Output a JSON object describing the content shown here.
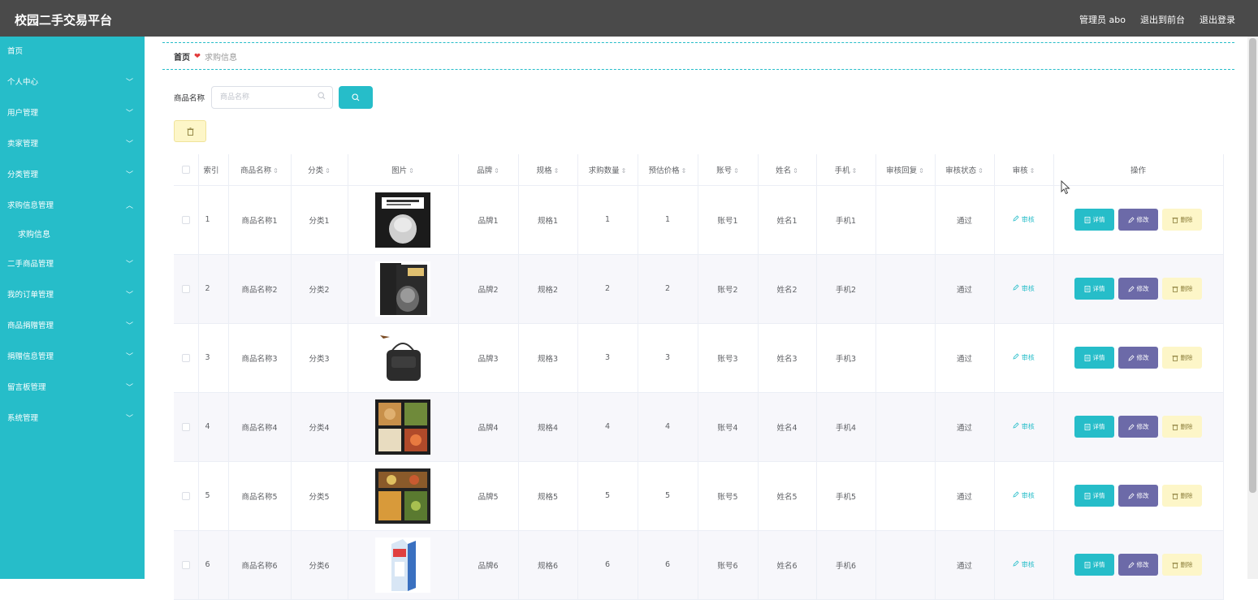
{
  "app": {
    "title": "校园二手交易平台",
    "user_label": "管理员 abo",
    "to_front": "退出到前台",
    "logout": "退出登录"
  },
  "sidebar": {
    "items": [
      {
        "label": "首页",
        "chevron": ""
      },
      {
        "label": "个人中心",
        "chevron": "﹀"
      },
      {
        "label": "用户管理",
        "chevron": "﹀"
      },
      {
        "label": "卖家管理",
        "chevron": "﹀"
      },
      {
        "label": "分类管理",
        "chevron": "﹀"
      },
      {
        "label": "求购信息管理",
        "chevron": "︿"
      },
      {
        "label": "求购信息",
        "chevron": ""
      },
      {
        "label": "二手商品管理",
        "chevron": "﹀"
      },
      {
        "label": "我的订单管理",
        "chevron": "﹀"
      },
      {
        "label": "商品捐赠管理",
        "chevron": "﹀"
      },
      {
        "label": "捐赠信息管理",
        "chevron": "﹀"
      },
      {
        "label": "留言板管理",
        "chevron": "﹀"
      },
      {
        "label": "系统管理",
        "chevron": "﹀"
      }
    ]
  },
  "breadcrumb": {
    "home": "首页",
    "separator": "❤",
    "current": "求购信息"
  },
  "search": {
    "label": "商品名称",
    "placeholder": "商品名称"
  },
  "icons": {
    "search": "search-icon",
    "delete": "trash-icon",
    "detail": "doc-icon",
    "edit": "pencil-icon",
    "sort": "sort-icon"
  },
  "colors": {
    "accent": "#26bdc9",
    "topbar": "#4a4a4a",
    "edit_btn": "#6c6aa8",
    "delete_btn": "#fdf6c8"
  },
  "table": {
    "headers": [
      "索引",
      "商品名称",
      "分类",
      "图片",
      "品牌",
      "规格",
      "求购数量",
      "预估价格",
      "账号",
      "姓名",
      "手机",
      "审核回复",
      "审核状态",
      "审核",
      "操作"
    ],
    "sort_glyph": "⇕",
    "audit_link": "审核",
    "btn_detail": "详情",
    "btn_edit": "修改",
    "btn_delete": "删除",
    "rows": [
      {
        "index": "1",
        "name": "商品名称1",
        "category": "分类1",
        "image": "book-cover",
        "brand": "品牌1",
        "spec": "规格1",
        "qty": "1",
        "price": "1",
        "account": "账号1",
        "realname": "姓名1",
        "phone": "手机1",
        "reply": "",
        "status": "通过"
      },
      {
        "index": "2",
        "name": "商品名称2",
        "category": "分类2",
        "image": "book-set",
        "brand": "品牌2",
        "spec": "规格2",
        "qty": "2",
        "price": "2",
        "account": "账号2",
        "realname": "姓名2",
        "phone": "手机2",
        "reply": "",
        "status": "通过"
      },
      {
        "index": "3",
        "name": "商品名称3",
        "category": "分类3",
        "image": "shoulder-bag",
        "brand": "品牌3",
        "spec": "规格3",
        "qty": "3",
        "price": "3",
        "account": "账号3",
        "realname": "姓名3",
        "phone": "手机3",
        "reply": "",
        "status": "通过"
      },
      {
        "index": "4",
        "name": "商品名称4",
        "category": "分类4",
        "image": "bento-box",
        "brand": "品牌4",
        "spec": "规格4",
        "qty": "4",
        "price": "4",
        "account": "账号4",
        "realname": "姓名4",
        "phone": "手机4",
        "reply": "",
        "status": "通过"
      },
      {
        "index": "5",
        "name": "商品名称5",
        "category": "分类5",
        "image": "bento-box-2",
        "brand": "品牌5",
        "spec": "规格5",
        "qty": "5",
        "price": "5",
        "account": "账号5",
        "realname": "姓名5",
        "phone": "手机5",
        "reply": "",
        "status": "通过"
      },
      {
        "index": "6",
        "name": "商品名称6",
        "category": "分类6",
        "image": "milk-carton",
        "brand": "品牌6",
        "spec": "规格6",
        "qty": "6",
        "price": "6",
        "account": "账号6",
        "realname": "姓名6",
        "phone": "手机6",
        "reply": "",
        "status": "通过"
      }
    ]
  }
}
